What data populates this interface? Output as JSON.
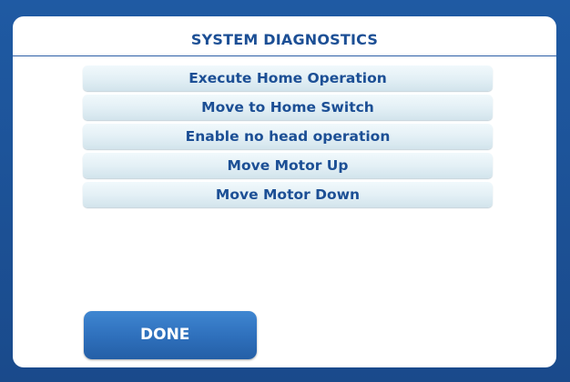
{
  "dialog": {
    "title": "SYSTEM DIAGNOSTICS"
  },
  "menu": {
    "items": [
      {
        "label": "Execute Home Operation"
      },
      {
        "label": "Move to Home Switch"
      },
      {
        "label": "Enable no head operation"
      },
      {
        "label": "Move Motor Up"
      },
      {
        "label": "Move Motor Down"
      }
    ]
  },
  "footer": {
    "done_label": "DONE"
  },
  "colors": {
    "frame": "#1d4f94",
    "panel": "#ffffff",
    "title_text": "#1c4f95",
    "menu_item_bg": "#e2eff5",
    "done_button": "#2e6fbb"
  }
}
